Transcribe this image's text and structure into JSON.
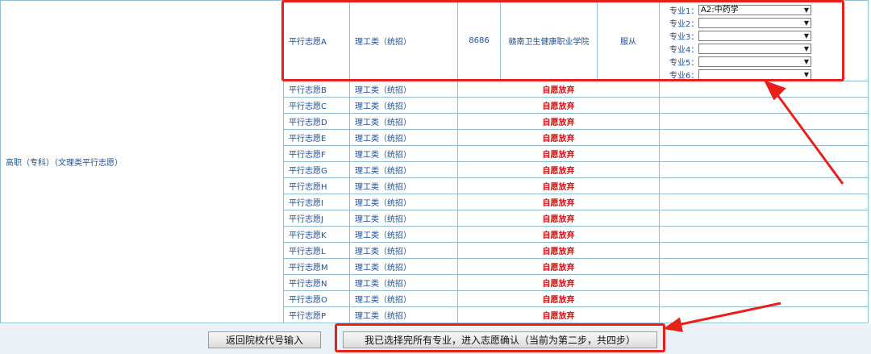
{
  "category": "高职（专科）（文理类平行志愿）",
  "first_row": {
    "volunteer": "平行志愿A",
    "type": "理工类（统招）",
    "code": "8686",
    "school": "赣南卫生健康职业学院",
    "adjust": "服从",
    "majors": [
      {
        "label": "专业1：",
        "value": "A2:中药学"
      },
      {
        "label": "专业2：",
        "value": ""
      },
      {
        "label": "专业3：",
        "value": ""
      },
      {
        "label": "专业4：",
        "value": ""
      },
      {
        "label": "专业5：",
        "value": ""
      },
      {
        "label": "专业6：",
        "value": ""
      }
    ]
  },
  "rows": [
    {
      "volunteer": "平行志愿B",
      "type": "理工类（统招）",
      "status": "自愿放弃"
    },
    {
      "volunteer": "平行志愿C",
      "type": "理工类（统招）",
      "status": "自愿放弃"
    },
    {
      "volunteer": "平行志愿D",
      "type": "理工类（统招）",
      "status": "自愿放弃"
    },
    {
      "volunteer": "平行志愿E",
      "type": "理工类（统招）",
      "status": "自愿放弃"
    },
    {
      "volunteer": "平行志愿F",
      "type": "理工类（统招）",
      "status": "自愿放弃"
    },
    {
      "volunteer": "平行志愿G",
      "type": "理工类（统招）",
      "status": "自愿放弃"
    },
    {
      "volunteer": "平行志愿H",
      "type": "理工类（统招）",
      "status": "自愿放弃"
    },
    {
      "volunteer": "平行志愿I",
      "type": "理工类（统招）",
      "status": "自愿放弃"
    },
    {
      "volunteer": "平行志愿J",
      "type": "理工类（统招）",
      "status": "自愿放弃"
    },
    {
      "volunteer": "平行志愿K",
      "type": "理工类（统招）",
      "status": "自愿放弃"
    },
    {
      "volunteer": "平行志愿L",
      "type": "理工类（统招）",
      "status": "自愿放弃"
    },
    {
      "volunteer": "平行志愿M",
      "type": "理工类（统招）",
      "status": "自愿放弃"
    },
    {
      "volunteer": "平行志愿N",
      "type": "理工类（统招）",
      "status": "自愿放弃"
    },
    {
      "volunteer": "平行志愿O",
      "type": "理工类（统招）",
      "status": "自愿放弃"
    },
    {
      "volunteer": "平行志愿P",
      "type": "理工类（统招）",
      "status": "自愿放弃"
    }
  ],
  "buttons": {
    "back": "返回院校代号输入",
    "confirm": "我已选择完所有专业，进入志愿确认（当前为第二步，共四步）"
  },
  "colors": {
    "annotation": "#e8201a",
    "abandon_text": "#c41818",
    "grid_border": "#8fbfd6",
    "cell_text": "#1f4f8f"
  }
}
